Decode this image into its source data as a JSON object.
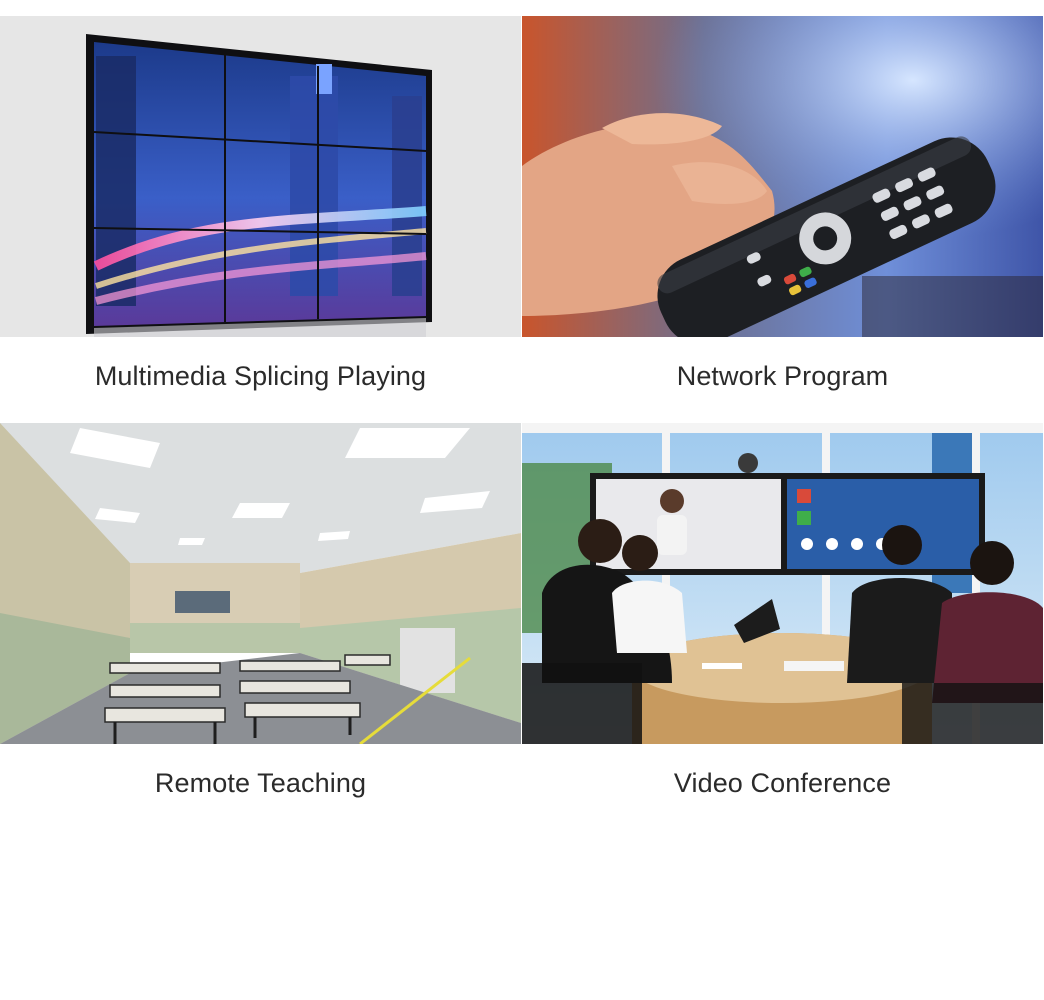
{
  "items": [
    {
      "label": "Multimedia Splicing Playing",
      "image_subject": "video wall of night city skyline"
    },
    {
      "label": "Network Program",
      "image_subject": "hand holding TV remote control"
    },
    {
      "label": "Remote Teaching",
      "image_subject": "empty classroom with desks and projector"
    },
    {
      "label": "Video Conference",
      "image_subject": "business meeting in front of conference screens"
    }
  ]
}
